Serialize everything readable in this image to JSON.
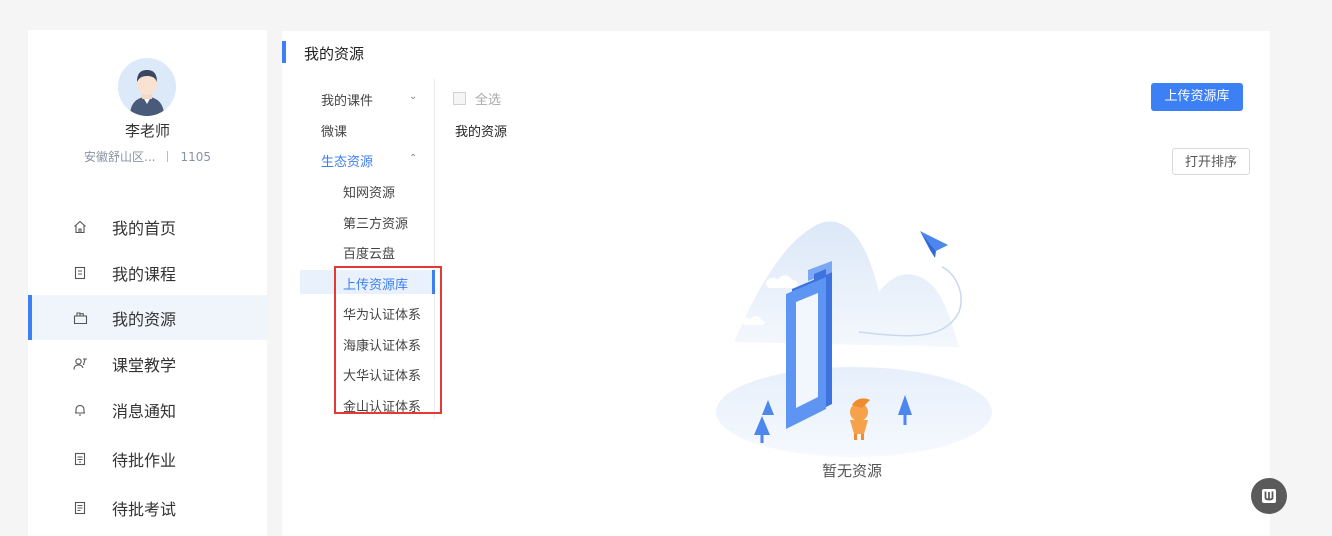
{
  "profile": {
    "name": "李老师",
    "school": "安徽舒山区...",
    "code": "1105"
  },
  "nav": [
    {
      "label": "我的首页",
      "icon": "home-icon"
    },
    {
      "label": "我的课程",
      "icon": "course-icon"
    },
    {
      "label": "我的资源",
      "icon": "resource-icon",
      "active": true
    },
    {
      "label": "课堂教学",
      "icon": "teaching-icon"
    },
    {
      "label": "消息通知",
      "icon": "bell-icon"
    },
    {
      "label": "待批作业",
      "icon": "homework-icon"
    },
    {
      "label": "待批考试",
      "icon": "exam-icon"
    }
  ],
  "main": {
    "title": "我的资源",
    "tree": {
      "my_courseware": "我的课件",
      "micro_course": "微课",
      "eco_resources": "生态资源",
      "children": [
        "知网资源",
        "第三方资源",
        "百度云盘",
        "上传资源库",
        "华为认证体系",
        "海康认证体系",
        "大华认证体系",
        "金山认证体系"
      ],
      "selected": "上传资源库"
    },
    "select_all": "全选",
    "folder_label": "我的资源",
    "upload_button": "上传资源库",
    "sort_button": "打开排序",
    "empty_text": "暂无资源"
  },
  "colors": {
    "accent": "#3d7ff4",
    "highlight_box": "#e53935",
    "background": "#f5f5f5"
  }
}
